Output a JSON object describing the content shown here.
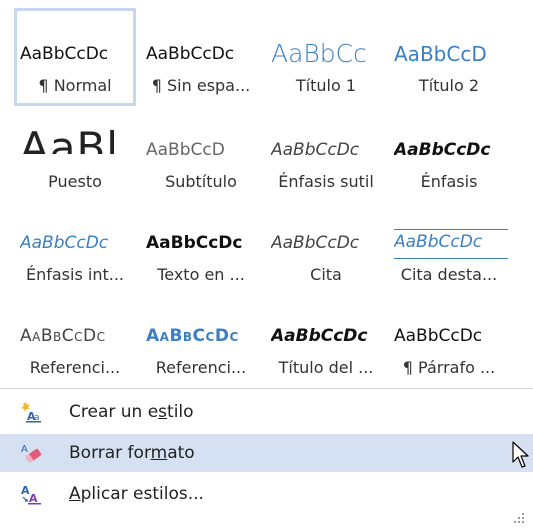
{
  "gallery": {
    "row1": [
      {
        "sample": "AaBbCcDc",
        "label": "¶ Normal"
      },
      {
        "sample": "AaBbCcDc",
        "label": "¶ Sin espa..."
      },
      {
        "sample": "AaBbCc",
        "label": "Título 1"
      },
      {
        "sample": "AaBbCcD",
        "label": "Título 2"
      }
    ],
    "row2": [
      {
        "sample": "AaBl",
        "label": "Puesto"
      },
      {
        "sample": "AaBbCcD",
        "label": "Subtítulo"
      },
      {
        "sample": "AaBbCcDc",
        "label": "Énfasis sutil"
      },
      {
        "sample": "AaBbCcDc",
        "label": "Énfasis"
      }
    ],
    "row3": [
      {
        "sample": "AaBbCcDc",
        "label": "Énfasis int..."
      },
      {
        "sample": "AaBbCcDc",
        "label": "Texto en ..."
      },
      {
        "sample": "AaBbCcDc",
        "label": "Cita"
      },
      {
        "sample": "AaBbCcDc",
        "label": "Cita desta..."
      }
    ],
    "row4": [
      {
        "sample": "AaBbCcDc",
        "label": "Referenci..."
      },
      {
        "sample": "AaBbCcDc",
        "label": "Referenci..."
      },
      {
        "sample": "AaBbCcDc",
        "label": "Título del ..."
      },
      {
        "sample": "AaBbCcDc",
        "label": "¶ Párrafo ..."
      }
    ]
  },
  "menu": {
    "create_style": {
      "pre": "Crear un e",
      "ul": "s",
      "post": "tilo",
      "icon": "create-style-icon"
    },
    "clear_format": {
      "pre": "Borrar for",
      "ul": "m",
      "post": "ato",
      "icon": "eraser-icon"
    },
    "apply_styles": {
      "pre": "",
      "ul": "A",
      "post": "plicar estilos...",
      "icon": "apply-styles-icon"
    }
  },
  "colors": {
    "accent": "#3b7fc4",
    "selection_border": "#c5d8ee",
    "hover": "#d5e1f2"
  }
}
